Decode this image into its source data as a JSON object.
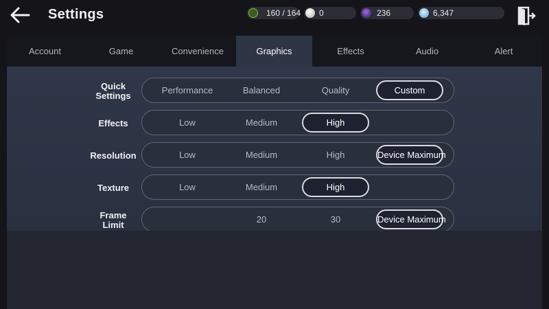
{
  "header": {
    "title": "Settings",
    "resources": [
      {
        "name": "stamina",
        "value": "160 / 164",
        "icon": "stamina-icon",
        "color": "#7dbb3a"
      },
      {
        "name": "pearl",
        "value": "0",
        "icon": "pearl-icon",
        "color": "#d8d2cc"
      },
      {
        "name": "dark-gem",
        "value": "236",
        "icon": "dark-gem-icon",
        "color": "#6a3cc0"
      },
      {
        "name": "silver",
        "value": "6,347",
        "icon": "silver-coin-icon",
        "color": "#8ec8e8"
      }
    ]
  },
  "tabs": [
    {
      "label": "Account",
      "active": false
    },
    {
      "label": "Game",
      "active": false
    },
    {
      "label": "Convenience",
      "active": false
    },
    {
      "label": "Graphics",
      "active": true
    },
    {
      "label": "Effects",
      "active": false
    },
    {
      "label": "Audio",
      "active": false
    },
    {
      "label": "Alert",
      "active": false
    }
  ],
  "settings": [
    {
      "label_line1": "Quick",
      "label_line2": "Settings",
      "options": [
        "Performance",
        "Balanced",
        "Quality",
        "Custom"
      ],
      "selected": "Custom"
    },
    {
      "label_line1": "Effects",
      "label_line2": "",
      "options": [
        "Low",
        "Medium",
        "High",
        ""
      ],
      "selected": "High"
    },
    {
      "label_line1": "Resolution",
      "label_line2": "",
      "options": [
        "Low",
        "Medium",
        "High",
        "Device Maximum"
      ],
      "selected": "Device Maximum"
    },
    {
      "label_line1": "Texture",
      "label_line2": "",
      "options": [
        "Low",
        "Medium",
        "High",
        ""
      ],
      "selected": "High"
    },
    {
      "label_line1": "Frame",
      "label_line2": "Limit",
      "options": [
        "",
        "20",
        "30",
        "Device Maximum"
      ],
      "selected": "Device Maximum"
    }
  ]
}
